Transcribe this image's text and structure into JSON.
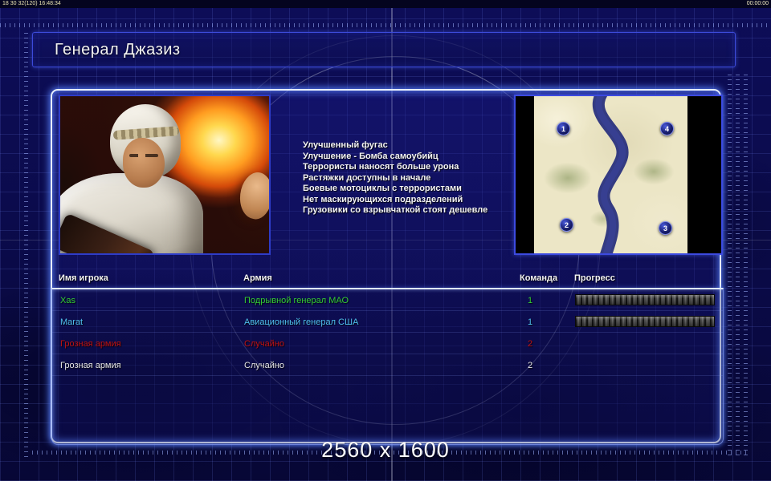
{
  "hud": {
    "top_left_timer": "18 30 32(120) 16:48:34",
    "top_right_timer": "00:00:00"
  },
  "header": {
    "title": "Генерал Джазиз"
  },
  "briefing": {
    "bonuses": [
      "Улучшенный фугас",
      "Улучшение - Бомба самоубийц",
      "Террористы наносят больше урона",
      "Растяжки доступны в начале",
      "Боевые мотоциклы с террористами",
      "Нет маскирующихся подразделений",
      "Грузовики со взрывчаткой стоят дешевле"
    ]
  },
  "map_preview": {
    "markers": [
      "1",
      "2",
      "3",
      "4"
    ]
  },
  "players_table": {
    "columns": [
      "Имя игрока",
      "Армия",
      "Команда",
      "Прогресс"
    ],
    "rows": [
      {
        "name": "Xas",
        "army": "Подрывной генерал МАО",
        "team": "1",
        "progress": 100,
        "color": "#33cc33"
      },
      {
        "name": "Marat",
        "army": "Авиационный генерал США",
        "team": "1",
        "progress": 100,
        "color": "#4fc0ee"
      },
      {
        "name": "Грозная армия",
        "army": "Случайно",
        "team": "2",
        "progress": null,
        "color": "#c01212"
      },
      {
        "name": "Грозная армия",
        "army": "Случайно",
        "team": "2",
        "progress": null,
        "color": "#e6e6e6"
      }
    ]
  },
  "footer": {
    "resolution": "2560 x 1600"
  },
  "colors": {
    "accent_glow": "#5f7cff",
    "frame_border": "#3c4ada",
    "team1_a": "#33cc33",
    "team1_b": "#4fc0ee",
    "team2_a": "#c01212",
    "team2_b": "#e6e6e6"
  }
}
